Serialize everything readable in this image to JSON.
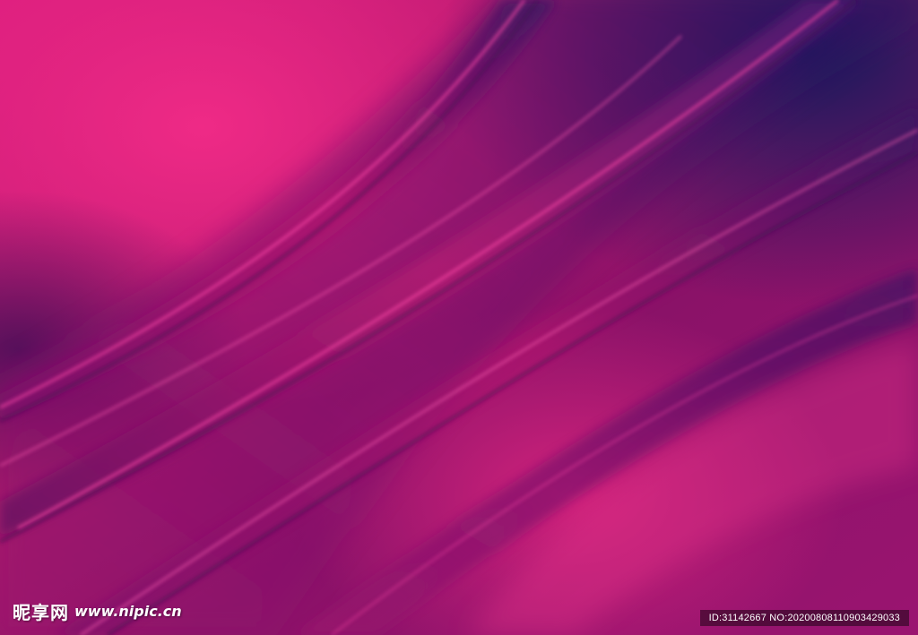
{
  "image": {
    "subject": "abstract-silk-waves",
    "colors": {
      "hot_pink": "#e0237f",
      "magenta": "#b0186e",
      "deep_purple": "#4a1060",
      "navy": "#1c1a5e",
      "highlight": "#ff4aa8"
    }
  },
  "watermark": {
    "site_cn": "昵享网",
    "site_url": "www.nipic.cn",
    "id_text": "ID:31142667 NO:20200808110903429033"
  }
}
